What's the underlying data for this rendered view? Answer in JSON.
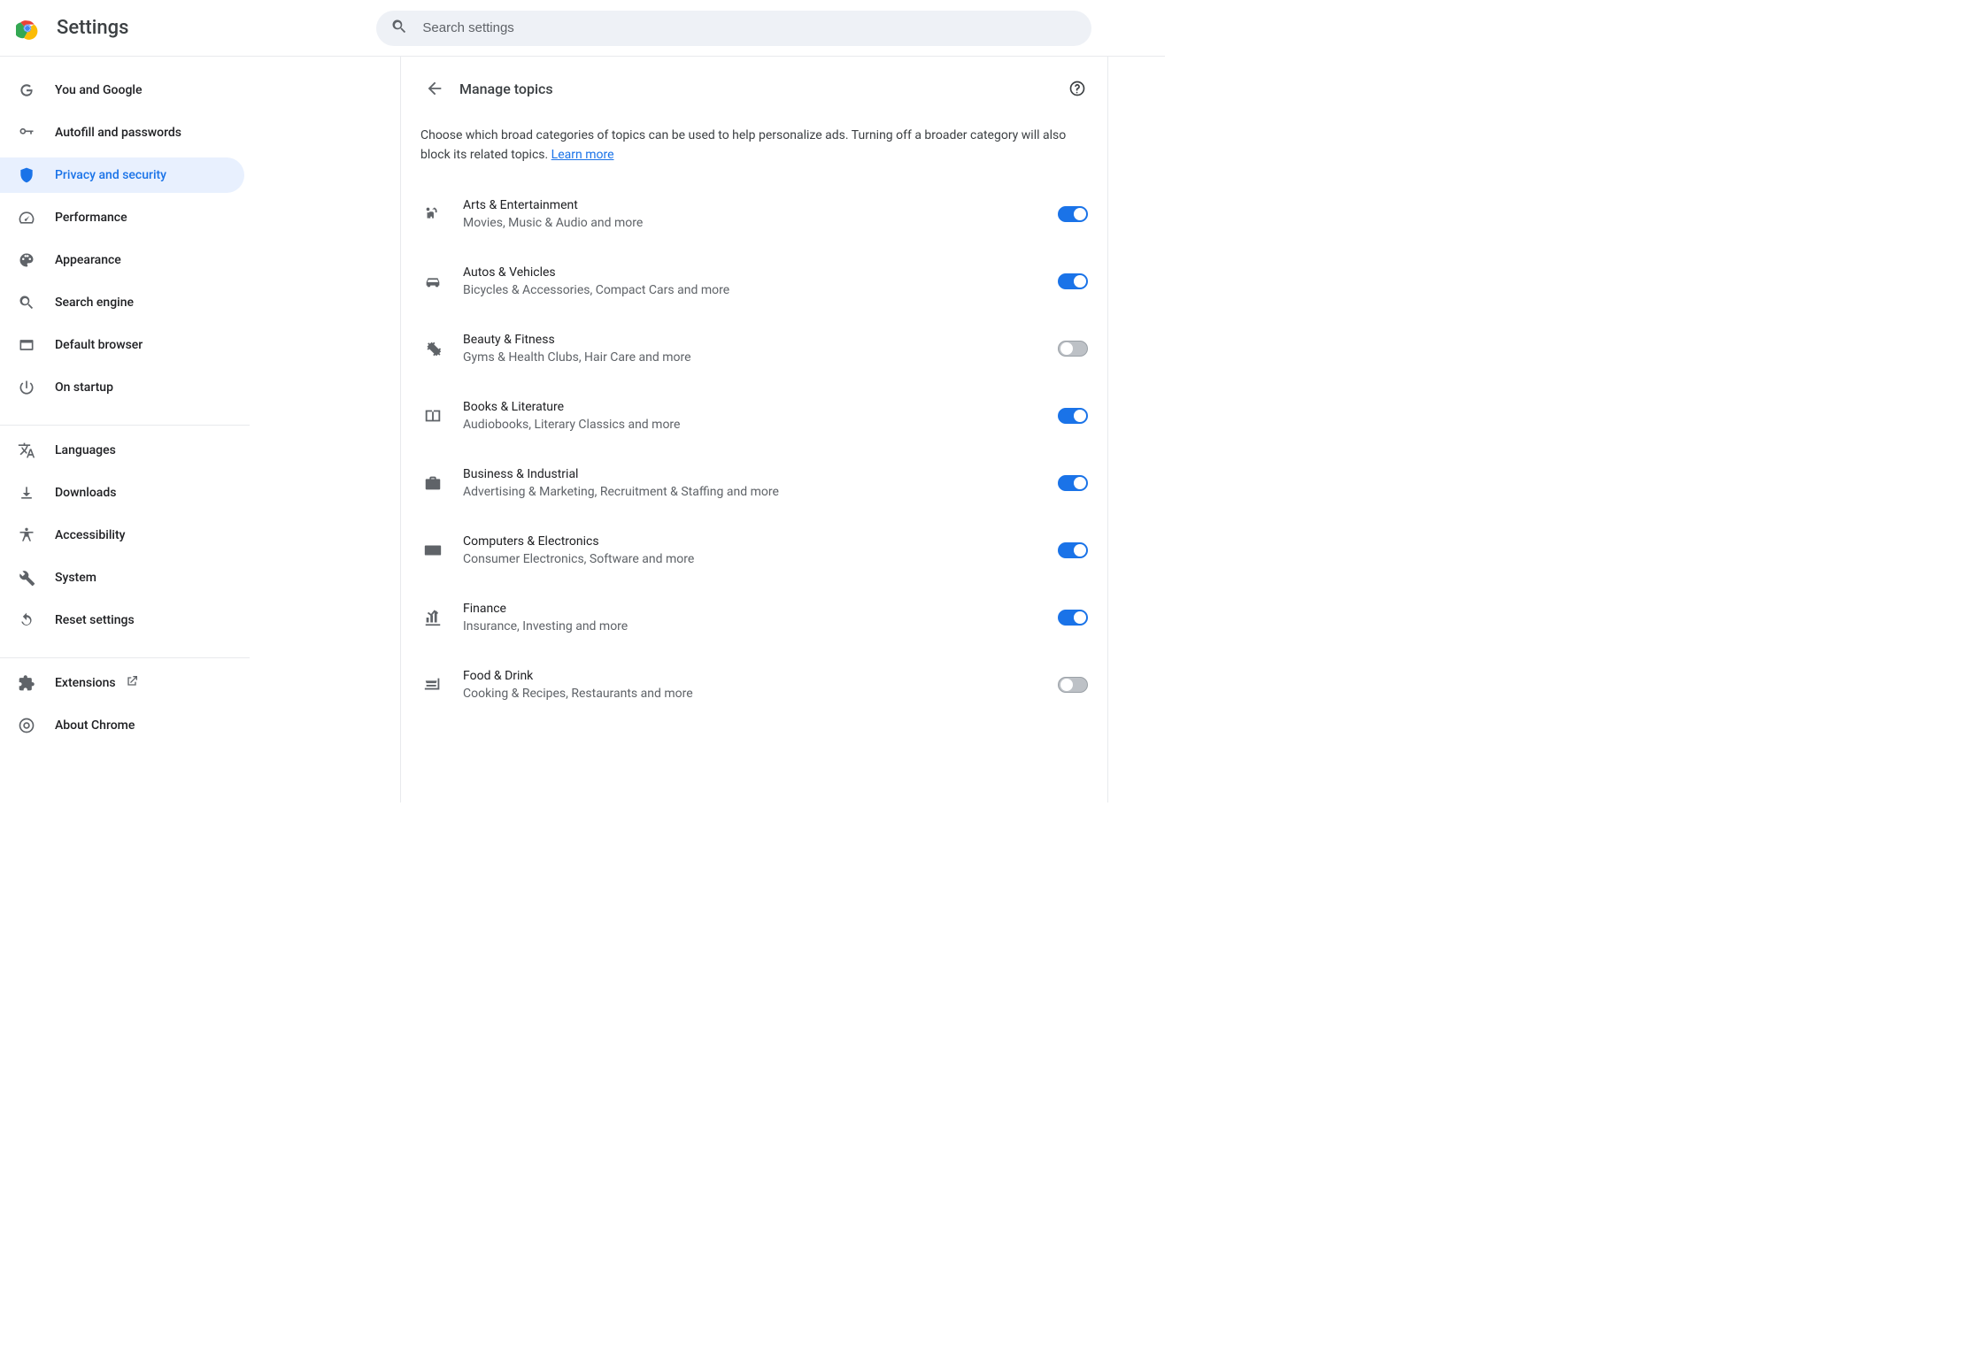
{
  "app": {
    "title": "Settings"
  },
  "search": {
    "placeholder": "Search settings"
  },
  "sidebar": {
    "sections": [
      {
        "items": [
          {
            "id": "you-and-google",
            "label": "You and Google",
            "icon": "google"
          },
          {
            "id": "autofill",
            "label": "Autofill and passwords",
            "icon": "key"
          },
          {
            "id": "privacy",
            "label": "Privacy and security",
            "icon": "shield",
            "active": true
          },
          {
            "id": "performance",
            "label": "Performance",
            "icon": "speed"
          },
          {
            "id": "appearance",
            "label": "Appearance",
            "icon": "palette"
          },
          {
            "id": "search-engine",
            "label": "Search engine",
            "icon": "search"
          },
          {
            "id": "default-browser",
            "label": "Default browser",
            "icon": "browser"
          },
          {
            "id": "on-startup",
            "label": "On startup",
            "icon": "power"
          }
        ]
      },
      {
        "items": [
          {
            "id": "languages",
            "label": "Languages",
            "icon": "translate"
          },
          {
            "id": "downloads",
            "label": "Downloads",
            "icon": "download"
          },
          {
            "id": "accessibility",
            "label": "Accessibility",
            "icon": "accessibility"
          },
          {
            "id": "system",
            "label": "System",
            "icon": "build"
          },
          {
            "id": "reset",
            "label": "Reset settings",
            "icon": "reset"
          }
        ]
      },
      {
        "items": [
          {
            "id": "extensions",
            "label": "Extensions",
            "icon": "extension",
            "external": true
          },
          {
            "id": "about",
            "label": "About Chrome",
            "icon": "chrome"
          }
        ]
      }
    ]
  },
  "page": {
    "title": "Manage topics",
    "intro_a": "Choose which broad categories of topics can be used to help personalize ads. Turning off a broader category will also block its related topics. ",
    "learn_more": "Learn more"
  },
  "topics": [
    {
      "id": "arts",
      "title": "Arts & Entertainment",
      "sub": "Movies, Music & Audio and more",
      "icon": "arts",
      "on": true
    },
    {
      "id": "autos",
      "title": "Autos & Vehicles",
      "sub": "Bicycles & Accessories, Compact Cars and more",
      "icon": "car",
      "on": true
    },
    {
      "id": "beauty",
      "title": "Beauty & Fitness",
      "sub": "Gyms & Health Clubs, Hair Care and more",
      "icon": "fitness",
      "on": false
    },
    {
      "id": "books",
      "title": "Books & Literature",
      "sub": "Audiobooks, Literary Classics and more",
      "icon": "book",
      "on": true
    },
    {
      "id": "business",
      "title": "Business & Industrial",
      "sub": "Advertising & Marketing, Recruitment & Staffing and more",
      "icon": "briefcase",
      "on": true
    },
    {
      "id": "computers",
      "title": "Computers & Electronics",
      "sub": "Consumer Electronics, Software and more",
      "icon": "keyboard",
      "on": true
    },
    {
      "id": "finance",
      "title": "Finance",
      "sub": "Insurance, Investing and more",
      "icon": "finance",
      "on": true
    },
    {
      "id": "food",
      "title": "Food & Drink",
      "sub": "Cooking & Recipes, Restaurants and more",
      "icon": "food",
      "on": false
    }
  ]
}
